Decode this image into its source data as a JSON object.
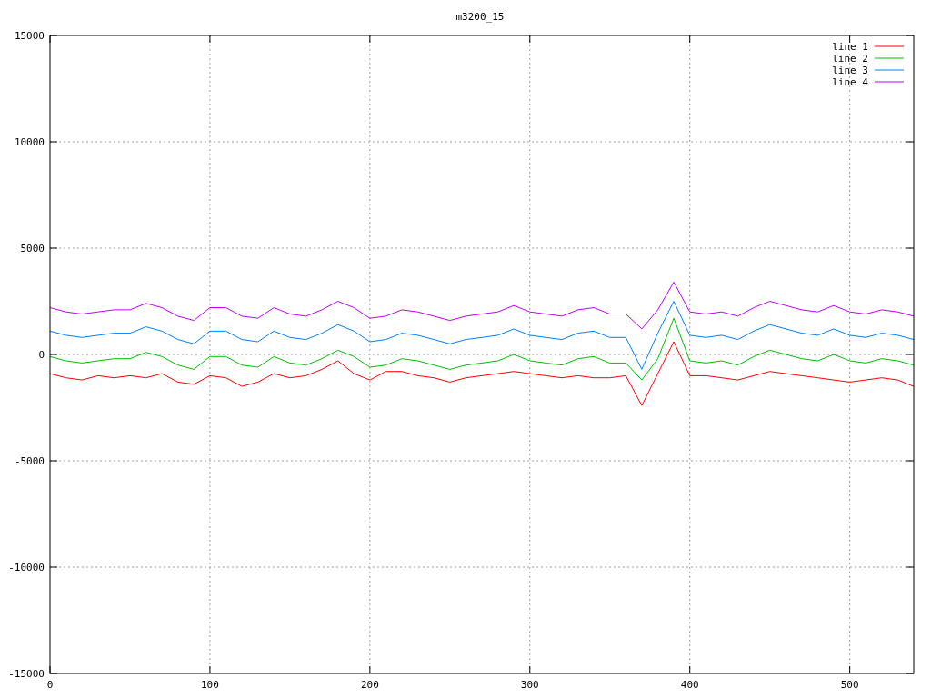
{
  "plot": {
    "chart_data": {
      "type": "line",
      "title": "m3200_15",
      "x": [
        0,
        10,
        20,
        30,
        40,
        50,
        60,
        70,
        80,
        90,
        100,
        110,
        120,
        130,
        140,
        150,
        160,
        170,
        180,
        190,
        200,
        210,
        220,
        230,
        240,
        250,
        260,
        270,
        280,
        290,
        300,
        310,
        320,
        330,
        340,
        350,
        360,
        370,
        380,
        390,
        400,
        410,
        420,
        430,
        440,
        450,
        460,
        470,
        480,
        490,
        500,
        510,
        520,
        530,
        540
      ],
      "xlim": [
        0,
        540
      ],
      "ylim": [
        -15000,
        15000
      ],
      "xticks": [
        0,
        100,
        200,
        300,
        400,
        500
      ],
      "yticks": [
        -15000,
        -10000,
        -5000,
        0,
        5000,
        10000,
        15000
      ],
      "grid": true,
      "legend": true,
      "series": [
        {
          "name": "line 1",
          "color": "#ff0000",
          "values": [
            -900,
            -1100,
            -1200,
            -1000,
            -1100,
            -1000,
            -1100,
            -900,
            -1300,
            -1400,
            -1000,
            -1100,
            -1500,
            -1300,
            -900,
            -1100,
            -1000,
            -700,
            -300,
            -900,
            -1200,
            -800,
            -800,
            -1000,
            -1100,
            -1300,
            -1100,
            -1000,
            -900,
            -800,
            -900,
            -1000,
            -1100,
            -1000,
            -1100,
            -1100,
            -1000,
            -2400,
            -900,
            600,
            -1000,
            -1000,
            -1100,
            -1200,
            -1000,
            -800,
            -900,
            -1000,
            -1100,
            -1200,
            -1300,
            -1200,
            -1100,
            -1200,
            -1500
          ]
        },
        {
          "name": "line 2",
          "color": "#00c000",
          "values": [
            -100,
            -300,
            -400,
            -300,
            -200,
            -200,
            100,
            -100,
            -500,
            -700,
            -100,
            -100,
            -500,
            -600,
            -100,
            -400,
            -500,
            -200,
            200,
            -100,
            -600,
            -500,
            -200,
            -300,
            -500,
            -700,
            -500,
            -400,
            -300,
            0,
            -300,
            -400,
            -500,
            -200,
            -100,
            -400,
            -400,
            -1200,
            -200,
            1700,
            -300,
            -400,
            -300,
            -500,
            -100,
            200,
            0,
            -200,
            -300,
            0,
            -300,
            -400,
            -200,
            -300,
            -500
          ]
        },
        {
          "name": "line 3",
          "color": "#0080ff",
          "values": [
            1100,
            900,
            800,
            900,
            1000,
            1000,
            1300,
            1100,
            700,
            500,
            1100,
            1100,
            700,
            600,
            1100,
            800,
            700,
            1000,
            1400,
            1100,
            600,
            700,
            1000,
            900,
            700,
            500,
            700,
            800,
            900,
            1200,
            900,
            800,
            700,
            1000,
            1100,
            800,
            800,
            -700,
            1000,
            2500,
            900,
            800,
            900,
            700,
            1100,
            1400,
            1200,
            1000,
            900,
            1200,
            900,
            800,
            1000,
            900,
            700
          ]
        },
        {
          "name": "line 4",
          "color": "#c000ff",
          "values": [
            2200,
            2000,
            1900,
            2000,
            2100,
            2100,
            2400,
            2200,
            1800,
            1600,
            2200,
            2200,
            1800,
            1700,
            2200,
            1900,
            1800,
            2100,
            2500,
            2200,
            1700,
            1800,
            2100,
            2000,
            1800,
            1600,
            1800,
            1900,
            2000,
            2300,
            2000,
            1900,
            1800,
            2100,
            2200,
            1900,
            1900,
            1200,
            2100,
            3400,
            2000,
            1900,
            2000,
            1800,
            2200,
            2500,
            2300,
            2100,
            2000,
            2300,
            2000,
            1900,
            2100,
            2000,
            1800
          ]
        }
      ]
    }
  }
}
